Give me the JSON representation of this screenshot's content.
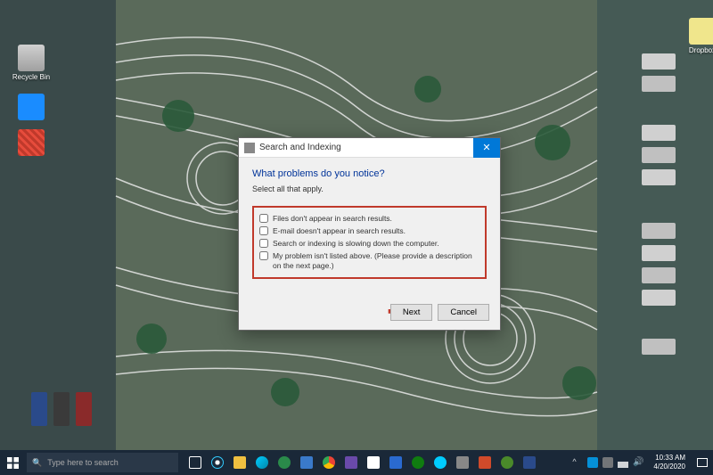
{
  "desktop": {
    "icons": {
      "recycle": "Recycle Bin",
      "shortcut1": "Dropbox"
    }
  },
  "dialog": {
    "title": "Search and Indexing",
    "heading": "What problems do you notice?",
    "subtitle": "Select all that apply.",
    "options": [
      "Files don't appear in search results.",
      "E-mail doesn't appear in search results.",
      "Search or indexing is slowing down the computer.",
      "My problem isn't listed above. (Please provide a description on the next page.)"
    ],
    "buttons": {
      "next": "Next",
      "cancel": "Cancel"
    },
    "close_symbol": "✕"
  },
  "taskbar": {
    "search_placeholder": "Type here to search",
    "time": "10:33 AM",
    "date": "4/20/2020"
  }
}
